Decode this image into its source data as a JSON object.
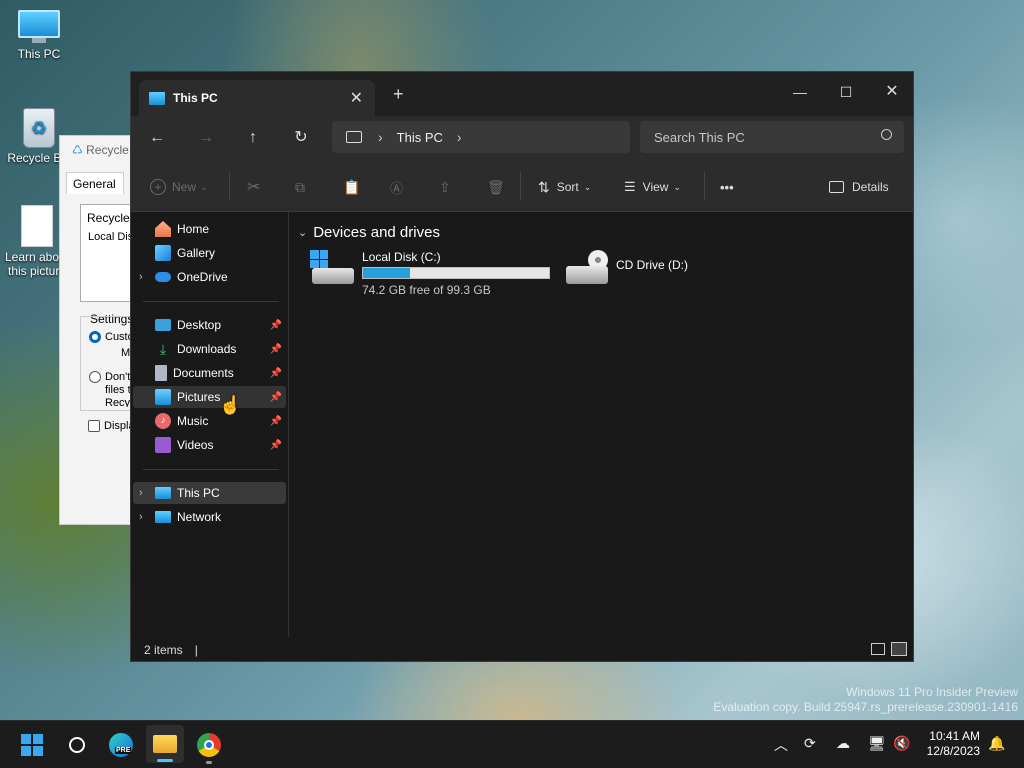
{
  "desktop": {
    "icons": [
      {
        "label": "This PC"
      },
      {
        "label": "Recycle Bin"
      },
      {
        "label": "Learn about this picture"
      }
    ],
    "watermark": {
      "line1": "Windows 11 Pro Insider Preview",
      "line2": "Evaluation copy. Build 25947.rs_prerelease.230901-1416"
    }
  },
  "recycle_dialog": {
    "title": "Recycle Bin Properties",
    "tab": "General",
    "list_header": "Recycle Bin Location",
    "list_item": "Local Disk",
    "settings_label": "Settings for selected location",
    "custom_label": "Custom size:",
    "custom_sub": "M",
    "dont_label": "Don't move files to the Recycle Bin. Remove files immediately when deleted.",
    "display_label": "Display delete confirmation dialog"
  },
  "explorer": {
    "tab_title": "This PC",
    "breadcrumb": [
      "This PC"
    ],
    "search_placeholder": "Search This PC",
    "commands": {
      "new": "New",
      "sort": "Sort",
      "view": "View",
      "more": "•••",
      "details": "Details"
    },
    "nav": {
      "quick": [
        {
          "label": "Home"
        },
        {
          "label": "Gallery"
        },
        {
          "label": "OneDrive"
        }
      ],
      "pinned": [
        {
          "label": "Desktop"
        },
        {
          "label": "Downloads"
        },
        {
          "label": "Documents"
        },
        {
          "label": "Pictures"
        },
        {
          "label": "Music"
        },
        {
          "label": "Videos"
        }
      ],
      "locations": [
        {
          "label": "This PC"
        },
        {
          "label": "Network"
        }
      ]
    },
    "group_title": "Devices and drives",
    "drives": [
      {
        "name": "Local Disk (C:)",
        "free_text": "74.2 GB free of 99.3 GB",
        "used_fraction": 0.253
      },
      {
        "name": "CD Drive (D:)"
      }
    ],
    "status": "2 items",
    "accent": "#4cc2ff"
  },
  "taskbar": {
    "time": "10:41 AM",
    "date": "12/8/2023",
    "edge_badge": "PRE"
  }
}
